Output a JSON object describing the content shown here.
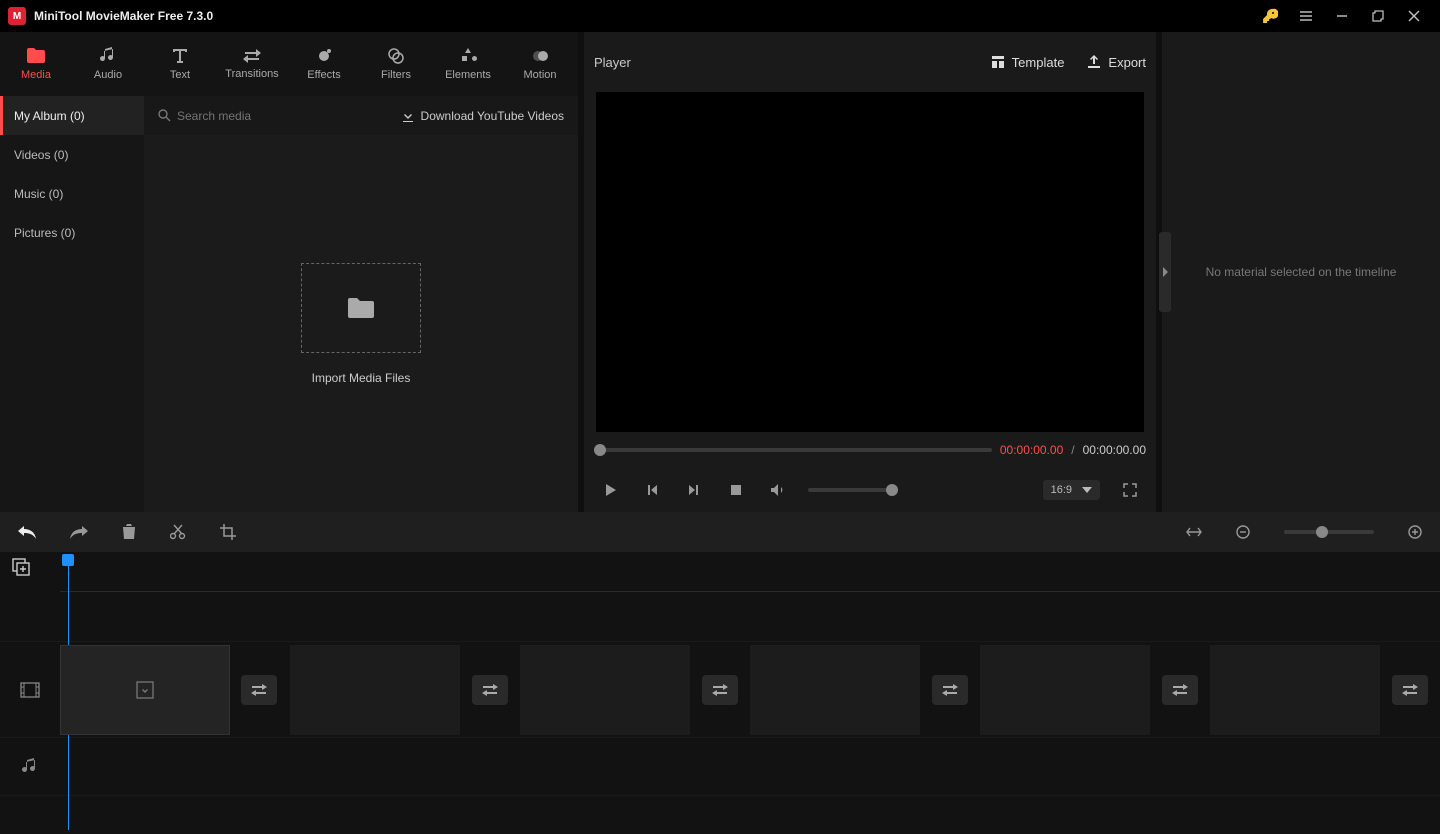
{
  "app": {
    "title": "MiniTool MovieMaker Free 7.3.0"
  },
  "tabs": [
    {
      "label": "Media",
      "icon": "folder"
    },
    {
      "label": "Audio",
      "icon": "music"
    },
    {
      "label": "Text",
      "icon": "text"
    },
    {
      "label": "Transitions",
      "icon": "swap"
    },
    {
      "label": "Effects",
      "icon": "sparkle"
    },
    {
      "label": "Filters",
      "icon": "filter"
    },
    {
      "label": "Elements",
      "icon": "shapes"
    },
    {
      "label": "Motion",
      "icon": "motion"
    }
  ],
  "albums": [
    {
      "label": "My Album (0)"
    },
    {
      "label": "Videos (0)"
    },
    {
      "label": "Music (0)"
    },
    {
      "label": "Pictures (0)"
    }
  ],
  "search": {
    "placeholder": "Search media"
  },
  "download_link": "Download YouTube Videos",
  "import_label": "Import Media Files",
  "player": {
    "title": "Player",
    "template_label": "Template",
    "export_label": "Export",
    "time_current": "00:00:00.00",
    "time_total": "00:00:00.00",
    "time_sep": "/",
    "ratio": "16:9"
  },
  "inspector": {
    "empty_msg": "No material selected on the timeline"
  }
}
